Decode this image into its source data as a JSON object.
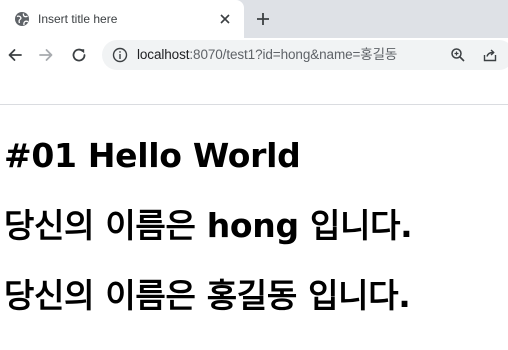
{
  "browser": {
    "tab": {
      "title": "Insert title here",
      "favicon": "globe-icon",
      "close_icon": "close-icon"
    },
    "new_tab_icon": "plus-icon",
    "nav": {
      "back_icon": "arrow-left-icon",
      "forward_icon": "arrow-right-icon",
      "reload_icon": "reload-icon"
    },
    "address_bar": {
      "info_icon": "info-icon",
      "url_host": "localhost",
      "url_rest": ":8070/test1?id=hong&name=홍길동",
      "zoom_icon": "zoom-icon",
      "share_icon": "share-icon"
    }
  },
  "page": {
    "heading1": "#01 Hello World",
    "heading2": "당신의 이름은 hong 입니다.",
    "heading3": "당신의 이름은 홍길동 입니다."
  },
  "colors": {
    "tabstrip": "#dee1e6",
    "omnibox": "#f1f3f4",
    "icon": "#5f6368",
    "heading": "#000000"
  }
}
